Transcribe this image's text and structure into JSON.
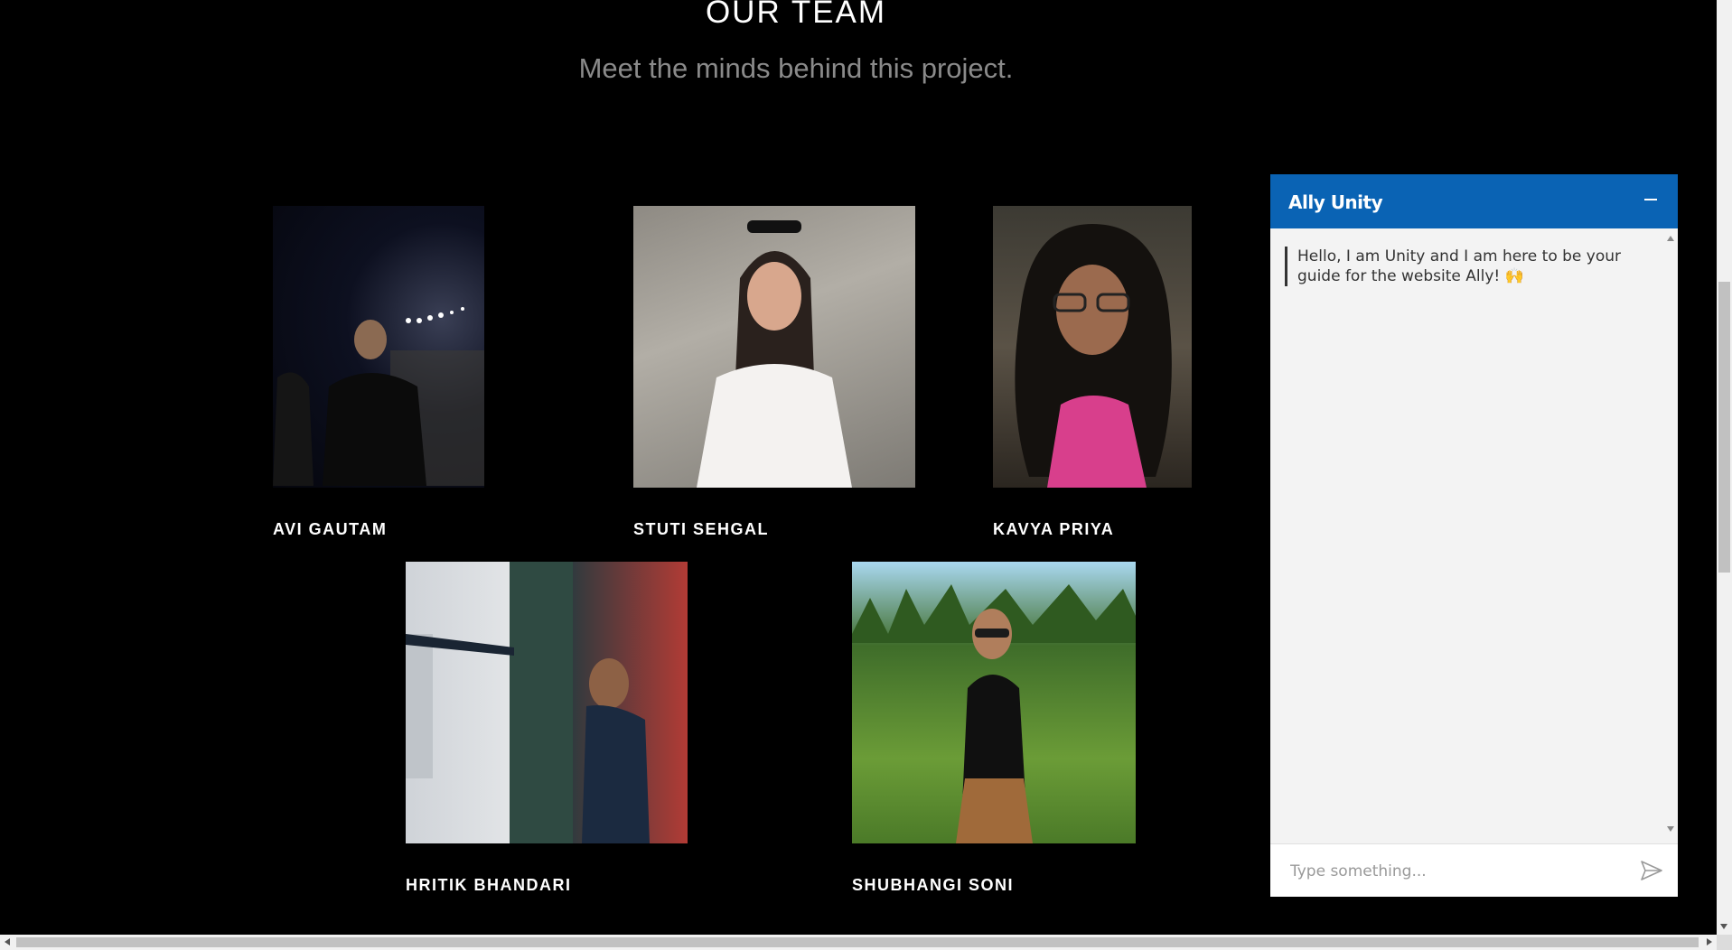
{
  "team_section": {
    "title": "OUR TEAM",
    "subtitle": "Meet the minds behind this project."
  },
  "members": [
    {
      "name": "AVI GAUTAM",
      "photo_icon": "avi-gautam-photo"
    },
    {
      "name": "STUTI SEHGAL",
      "photo_icon": "stuti-sehgal-photo"
    },
    {
      "name": "KAVYA PRIYA",
      "photo_icon": "kavya-priya-photo"
    },
    {
      "name": "HRITIK BHANDARI",
      "photo_icon": "hritik-bhandari-photo"
    },
    {
      "name": "SHUBHANGI SONI",
      "photo_icon": "shubhangi-soni-photo"
    }
  ],
  "chat": {
    "title": "Ally Unity",
    "messages": [
      {
        "text": "Hello, I am Unity and I am here to be your guide for the website Ally! 🙌"
      }
    ],
    "input": {
      "value": "",
      "placeholder": "Type something..."
    },
    "header_color": "#0a63b4",
    "minimize_icon": "minimize-icon",
    "send_icon": "send-icon"
  }
}
